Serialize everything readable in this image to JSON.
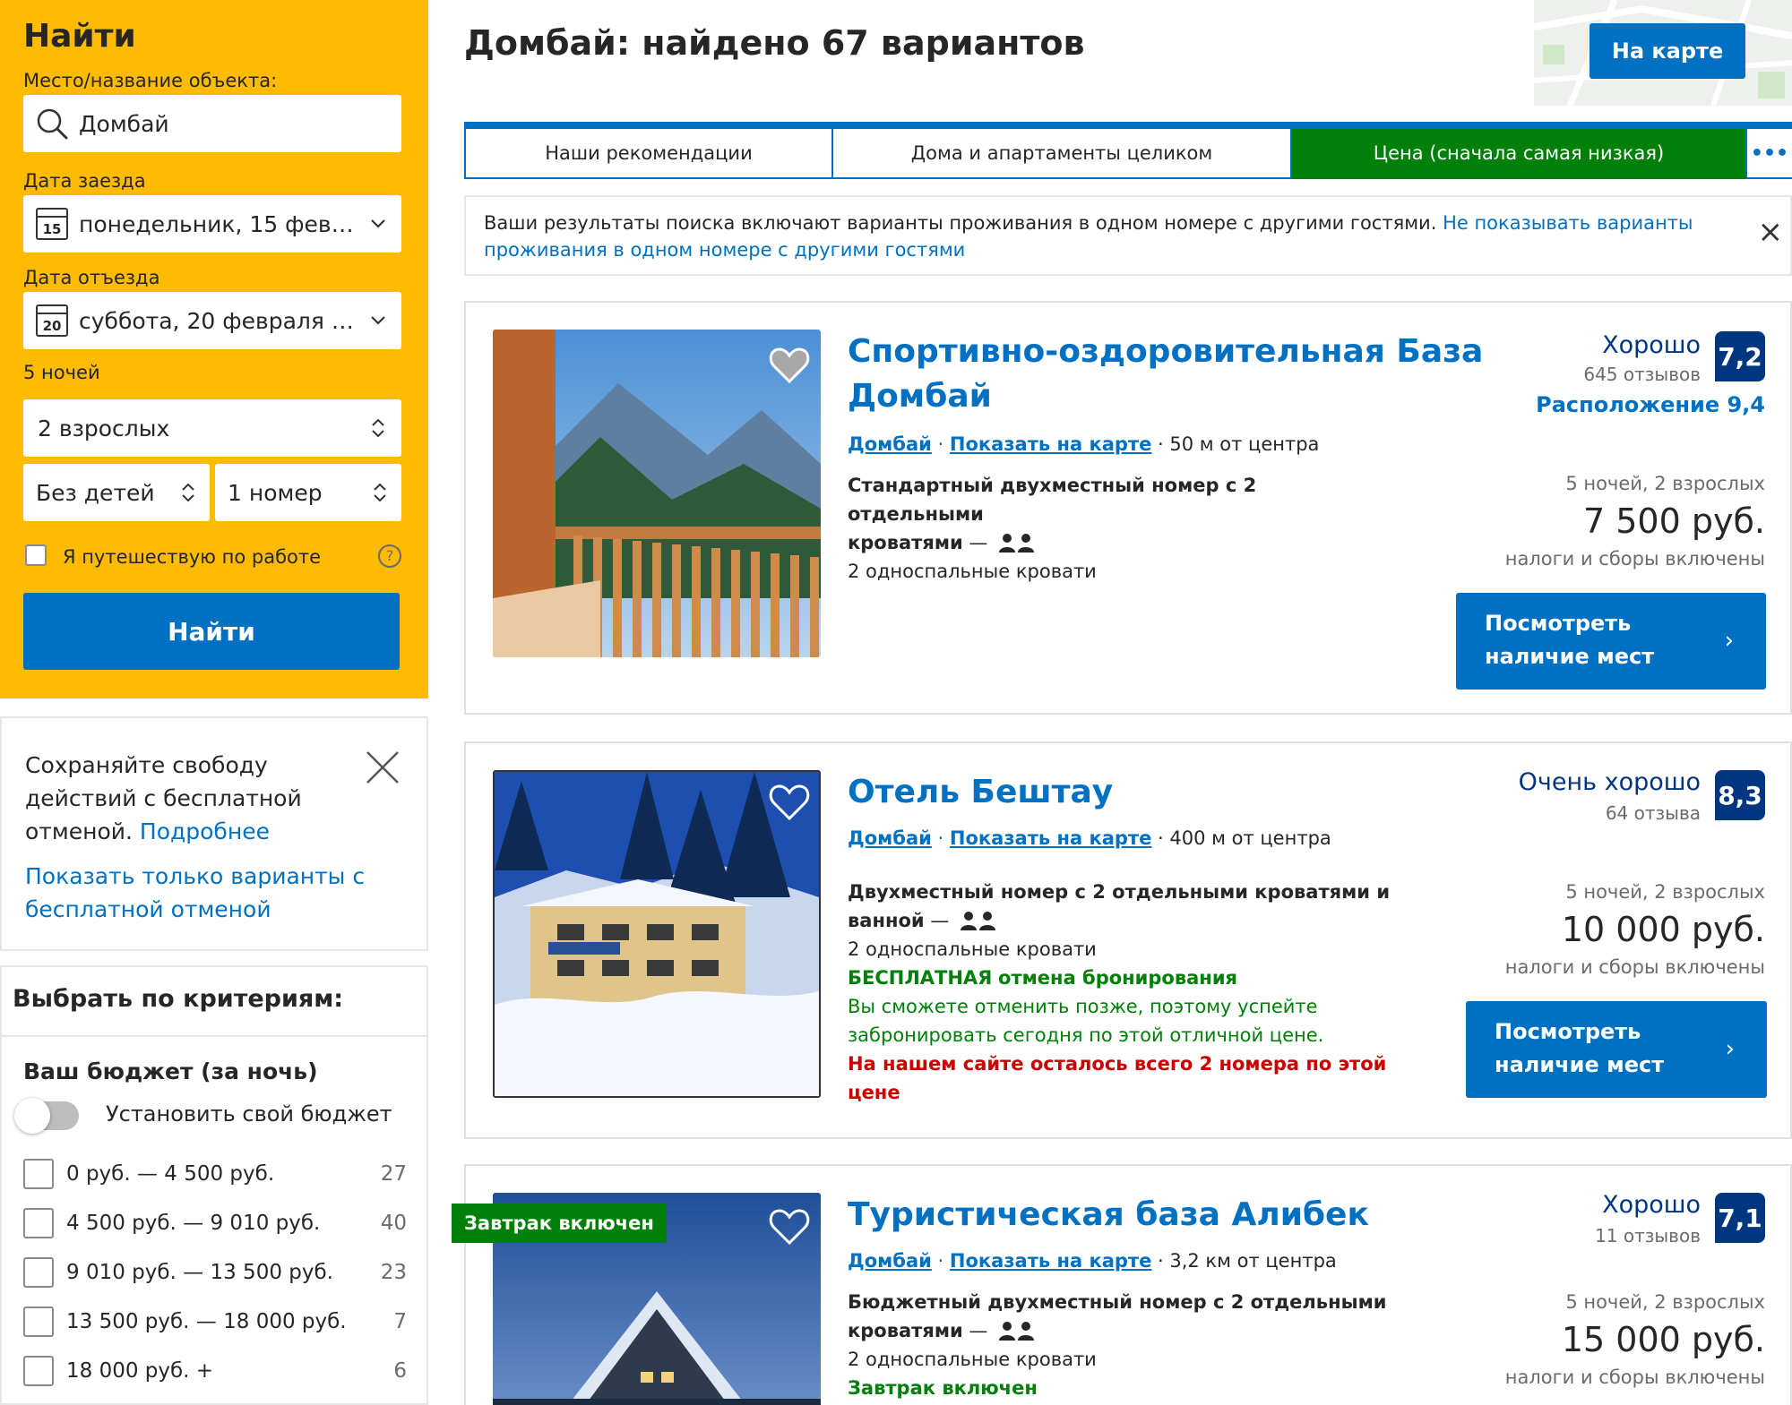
{
  "search": {
    "title": "Найти",
    "destination_label": "Место/название объекта:",
    "destination_value": "Домбай",
    "checkin_label": "Дата заезда",
    "checkin_day": "15",
    "checkin_value": "понедельник, 15 февра...",
    "checkout_label": "Дата отъезда",
    "checkout_day": "20",
    "checkout_value": "суббота, 20 февраля 2...",
    "nights": "5 ночей",
    "adults": "2 взрослых",
    "children": "Без детей",
    "rooms": "1 номер",
    "business_label": "Я путешествую по работе",
    "help_glyph": "?",
    "submit_label": "Найти"
  },
  "promo": {
    "text": "Сохраняйте свободу действий с бесплатной отменой.",
    "more_link": "Подробнее",
    "filter_link": "Показать только варианты с бесплатной отменой"
  },
  "filters": {
    "title": "Выбрать по критериям:",
    "budget_title": "Ваш бюджет (за ночь)",
    "custom_budget": "Установить свой бюджет",
    "ranges": [
      {
        "label": "0 руб. — 4 500 руб.",
        "count": "27"
      },
      {
        "label": "4 500 руб. — 9 010 руб.",
        "count": "40"
      },
      {
        "label": "9 010 руб. — 13 500 руб.",
        "count": "23"
      },
      {
        "label": "13 500 руб. — 18 000 руб.",
        "count": "7"
      },
      {
        "label": "18 000 руб. +",
        "count": "6"
      }
    ]
  },
  "main": {
    "title": "Домбай: найдено 67 вариантов",
    "map_button": "На карте",
    "tabs": [
      {
        "label": "Наши рекомендации"
      },
      {
        "label": "Дома и апартаменты целиком"
      },
      {
        "label": "Цена (сначала самая низкая)"
      },
      {
        "label": "•••"
      }
    ],
    "notice_text": "Ваши результаты поиска включают варианты проживания в одном номере с другими гостями.",
    "notice_link_1": "Не показывать",
    "notice_link_2": "варианты проживания в одном номере с другими гостями",
    "notice_close": "×"
  },
  "hotels": [
    {
      "name_line1": "Спортивно-оздоровительная База",
      "name_line2": "Домбай",
      "city": "Домбай",
      "map_link": "Показать на карте",
      "distance": "50 м от центра",
      "room_line1": "Стандартный двухместный номер с 2 отдельными",
      "room_line2": "кроватями",
      "dash": "—",
      "beds": "2 односпальные кровати",
      "score_word": "Хорошо",
      "reviews": "645 отзывов",
      "score": "7,2",
      "location_score": "Расположение 9,4",
      "nights_guests": "5 ночей, 2 взрослых",
      "price": "7 500 руб.",
      "tax_note": "налоги и сборы включены",
      "button_line1": "Посмотреть",
      "button_line2": "наличие мест",
      "chevron": "›"
    },
    {
      "name": "Отель Бештау",
      "city": "Домбай",
      "map_link": "Показать на карте",
      "distance": "400 м от центра",
      "room_line1": "Двухместный номер с 2 отдельными кроватями и",
      "room_line2": "ванной",
      "dash": "—",
      "beds": "2 односпальные кровати",
      "cancel_bold": "БЕСПЛАТНАЯ",
      "cancel_rest": "отмена бронирования",
      "cancel_line1": "Вы сможете отменить позже, поэтому успейте",
      "cancel_line2": "забронировать сегодня по этой отличной цене.",
      "scarcity_line1": "На нашем сайте осталось всего 2 номера по этой",
      "scarcity_line2": "цене",
      "score_word": "Очень хорошо",
      "reviews": "64 отзыва",
      "score": "8,3",
      "nights_guests": "5 ночей, 2 взрослых",
      "price": "10 000 руб.",
      "tax_note": "налоги и сборы включены",
      "button_line1": "Посмотреть",
      "button_line2": "наличие мест",
      "chevron": "›"
    },
    {
      "ribbon": "Завтрак включен",
      "name": "Туристическая база Алибек",
      "city": "Домбай",
      "map_link": "Показать на карте",
      "distance": "3,2 км от центра",
      "room_line1": "Бюджетный двухместный номер с 2 отдельными",
      "room_line2": "кроватями",
      "dash": "—",
      "beds": "2 односпальные кровати",
      "breakfast": "Завтрак включен",
      "score_word": "Хорошо",
      "reviews": "11 отзывов",
      "score": "7,1",
      "nights_guests": "5 ночей, 2 взрослых",
      "price": "15 000 руб.",
      "tax_note": "налоги и сборы включены"
    }
  ],
  "colors": {
    "brand_yellow": "#febb02",
    "brand_blue": "#0071c2",
    "dark_blue": "#003580",
    "active_tab_green": "#008009",
    "alert_red": "#cc0000"
  },
  "icons": {
    "search": "magnifier-icon",
    "calendar": "calendar-icon",
    "heart": "heart-icon",
    "guests": "two-persons-icon",
    "close": "close-icon"
  }
}
